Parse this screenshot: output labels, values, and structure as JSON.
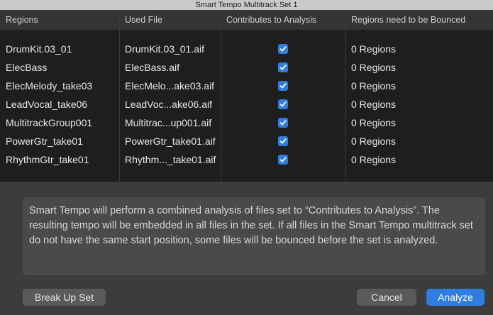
{
  "window": {
    "title": "Smart Tempo Multitrack Set 1"
  },
  "table": {
    "columns": [
      "Regions",
      "Used File",
      "Contributes to Analysis",
      "Regions need to be Bounced"
    ],
    "rows": [
      {
        "region": "DrumKit.03_01",
        "file": "DrumKit.03_01.aif",
        "contributes": true,
        "bounced": "0 Regions"
      },
      {
        "region": "ElecBass",
        "file": "ElecBass.aif",
        "contributes": true,
        "bounced": "0 Regions"
      },
      {
        "region": "ElecMelody_take03",
        "file": "ElecMelo...ake03.aif",
        "contributes": true,
        "bounced": "0 Regions"
      },
      {
        "region": "LeadVocal_take06",
        "file": "LeadVoc...ake06.aif",
        "contributes": true,
        "bounced": "0 Regions"
      },
      {
        "region": "MultitrackGroup001",
        "file": "Multitrac...up001.aif",
        "contributes": true,
        "bounced": "0 Regions"
      },
      {
        "region": "PowerGtr_take01",
        "file": "PowerGtr_take01.aif",
        "contributes": true,
        "bounced": "0 Regions"
      },
      {
        "region": "RhythmGtr_take01",
        "file": "Rhythm..._take01.aif",
        "contributes": true,
        "bounced": "0 Regions"
      }
    ]
  },
  "message": "Smart Tempo will perform a combined analysis of files set to “Contributes to Analysis”. The resulting tempo will be embedded in all files in the set. If all files in the Smart Tempo multitrack set do not have the same start position, some files will be bounced before the set is analyzed.",
  "buttons": {
    "break_up": "Break Up Set",
    "cancel": "Cancel",
    "analyze": "Analyze"
  },
  "colors": {
    "accent": "#2f7de1",
    "background": "#3c3c3c",
    "table_bg": "#1e1e1e"
  },
  "icons": {
    "checkbox": "checkmark-icon"
  }
}
